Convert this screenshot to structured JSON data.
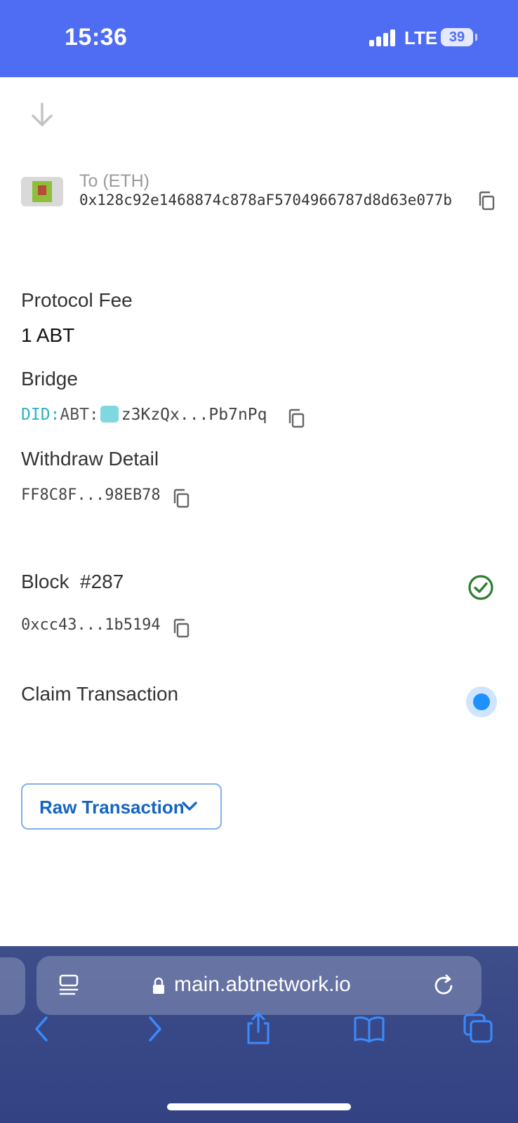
{
  "status_bar": {
    "time": "15:36",
    "network": "LTE",
    "battery": "39"
  },
  "to": {
    "label": "To (ETH)",
    "address": "0x128c92e1468874c878aF5704966787d8d63e077b"
  },
  "protocol_fee": {
    "label": "Protocol Fee",
    "value": "1 ABT"
  },
  "bridge": {
    "label": "Bridge",
    "did_prefix": "DID:",
    "did_chain": "ABT:",
    "address": "z3KzQx...Pb7nPq"
  },
  "withdraw_detail": {
    "label": "Withdraw Detail",
    "hash": "FF8C8F...98EB78"
  },
  "block": {
    "label": "Block",
    "number": "#287",
    "hash": "0xcc43...1b5194",
    "status_icon": "check-circle-icon"
  },
  "claim_transaction": {
    "label": "Claim Transaction",
    "status_icon": "pending-dot-icon"
  },
  "raw_transaction": {
    "label": "Raw Transaction"
  },
  "browser": {
    "url": "main.abtnetwork.io"
  },
  "colors": {
    "status_bar": "#4f6df2",
    "accent_blue": "#1565c0",
    "success_green": "#2e7d32",
    "did_teal": "#2bb3c0"
  }
}
